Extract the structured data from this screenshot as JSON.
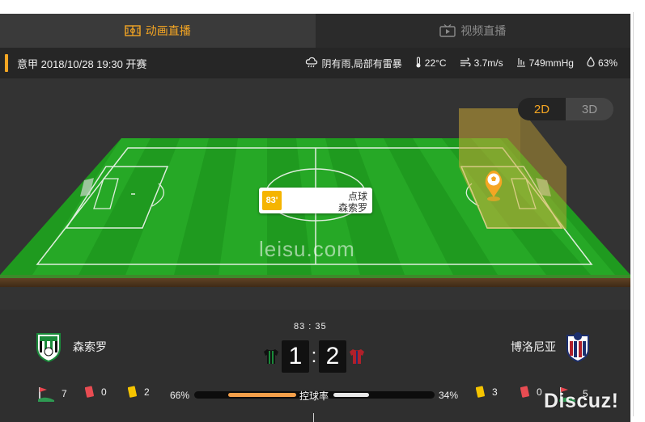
{
  "tabs": [
    {
      "label": "动画直播",
      "icon": "pitch-icon",
      "active": true
    },
    {
      "label": "视频直播",
      "icon": "tv-icon",
      "active": false
    }
  ],
  "match_info": "意甲 2018/10/28 19:30 开赛",
  "weather": {
    "condition": "阴有雨,局部有雷暴",
    "temperature": "22°C",
    "wind": "3.7m/s",
    "pressure": "749mmHg",
    "humidity": "63%"
  },
  "view_toggle": {
    "d2": "2D",
    "d3": "3D",
    "active": "2D"
  },
  "event": {
    "minute": "83'",
    "type": "点球",
    "team": "森索罗"
  },
  "watermark": "leisu.com",
  "scoreboard": {
    "time": "83 : 35",
    "home_team": "森索罗",
    "away_team": "博洛尼亚",
    "home_score": "1",
    "away_score": "2",
    "colon": ":"
  },
  "stats": {
    "home_corners": "7",
    "home_red": "0",
    "home_yellow": "2",
    "home_possession_text": "66%",
    "possession_label": "控球率",
    "away_possession_text": "34%",
    "away_yellow": "3",
    "away_red": "0",
    "away_corners": "5",
    "home_possession": 0.66,
    "away_possession": 0.34
  },
  "colors": {
    "accent": "#f5a623",
    "pitch": "#1f9a1f",
    "home_kit": "#1a8a3a",
    "away_kit": "#b0202a"
  },
  "footer_watermark": "Discuz!"
}
